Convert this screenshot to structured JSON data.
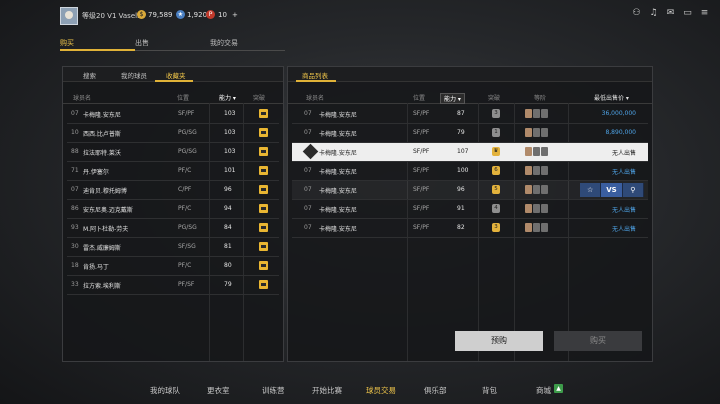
{
  "header": {
    "level_text": "等级20",
    "username_prefix": "V1",
    "username": "Vasell",
    "gold": "79,589",
    "blue": "1,920",
    "red": "10",
    "plus": "+"
  },
  "top_tabs": [
    "购买",
    "出售",
    "我的交易"
  ],
  "left_panel": {
    "subtabs": [
      "搜索",
      "我的球员",
      "收藏夹"
    ],
    "columns": {
      "name": "球员名",
      "position": "位置",
      "ability": "能力",
      "badge": "突破"
    },
    "rows": [
      {
        "num": "07",
        "name": "卡梅隆.安东尼",
        "pos": "SF/PF",
        "ability": "103"
      },
      {
        "num": "10",
        "name": "西西.比卢普斯",
        "pos": "PG/SG",
        "ability": "103"
      },
      {
        "num": "88",
        "name": "拉法耶特.莱沃",
        "pos": "PG/SG",
        "ability": "103"
      },
      {
        "num": "71",
        "name": "丹.伊塞尔",
        "pos": "PF/C",
        "ability": "101"
      },
      {
        "num": "07",
        "name": "迪肯贝.穆托姆博",
        "pos": "C/PF",
        "ability": "96"
      },
      {
        "num": "86",
        "name": "安东尼奥.迈克戴斯",
        "pos": "PF/C",
        "ability": "94"
      },
      {
        "num": "93",
        "name": "M.阿卜杜勒-劳夫",
        "pos": "PG/SG",
        "ability": "84"
      },
      {
        "num": "30",
        "name": "雷杰.威廉姆斯",
        "pos": "SF/SG",
        "ability": "81"
      },
      {
        "num": "18",
        "name": "肯扬.马丁",
        "pos": "PF/C",
        "ability": "80"
      },
      {
        "num": "33",
        "name": "拉方索.埃利斯",
        "pos": "PF/SF",
        "ability": "79"
      }
    ]
  },
  "right_panel": {
    "tab": "商品列表",
    "columns": {
      "name": "球员名",
      "position": "位置",
      "ability": "能力",
      "badge": "突破",
      "level": "等阶",
      "price": "最低出售价"
    },
    "rows": [
      {
        "num": "07",
        "name": "卡梅隆.安东尼",
        "pos": "SF/PF",
        "ability": "87",
        "mini": "3",
        "price": "36,000,000"
      },
      {
        "num": "07",
        "name": "卡梅隆.安东尼",
        "pos": "SF/PF",
        "ability": "79",
        "mini": "1",
        "price": "8,890,000"
      },
      {
        "num": "",
        "name": "卡梅隆.安东尼",
        "pos": "SF/PF",
        "ability": "107",
        "mini": "",
        "price": "无人出售"
      },
      {
        "num": "07",
        "name": "卡梅隆.安东尼",
        "pos": "SF/PF",
        "ability": "100",
        "mini": "6",
        "price": "无人出售"
      },
      {
        "num": "07",
        "name": "卡梅隆.安东尼",
        "pos": "SF/PF",
        "ability": "96",
        "mini": "5",
        "price": ""
      },
      {
        "num": "07",
        "name": "卡梅隆.安东尼",
        "pos": "SF/PF",
        "ability": "91",
        "mini": "4",
        "price": "无人出售"
      },
      {
        "num": "07",
        "name": "卡梅隆.安东尼",
        "pos": "SF/PF",
        "ability": "82",
        "mini": "3",
        "price": "无人出售"
      }
    ],
    "action_vs": "VS",
    "preorder": "预购",
    "buy": "购买"
  },
  "bottom_nav": [
    "我的球队",
    "更衣室",
    "训练营",
    "开始比赛",
    "球员交易",
    "俱乐部",
    "背包",
    "商城"
  ]
}
